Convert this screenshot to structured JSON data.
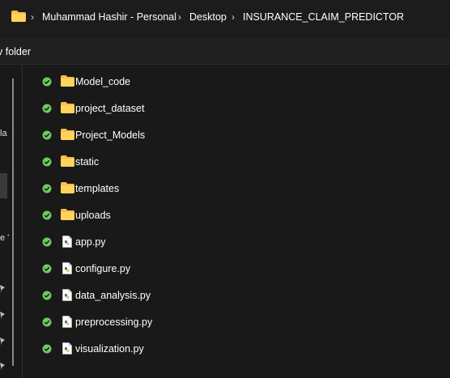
{
  "breadcrumb": [
    "Muhammad Hashir - Personal",
    "Desktop",
    "INSURANCE_CLAIM_PREDICTOR"
  ],
  "breadcrumb_separator": "›",
  "toolbar": {
    "new_folder_label": "v folder"
  },
  "nav_fragments": [
    "la",
    "e '"
  ],
  "files": [
    {
      "name": "Model_code",
      "type": "folder"
    },
    {
      "name": "project_dataset",
      "type": "folder"
    },
    {
      "name": "Project_Models",
      "type": "folder"
    },
    {
      "name": "static",
      "type": "folder"
    },
    {
      "name": "templates",
      "type": "folder"
    },
    {
      "name": "uploads",
      "type": "folder"
    },
    {
      "name": "app.py",
      "type": "python-file"
    },
    {
      "name": "configure.py",
      "type": "python-file"
    },
    {
      "name": "data_analysis.py",
      "type": "python-file"
    },
    {
      "name": "preprocessing.py",
      "type": "python-file"
    },
    {
      "name": "visualization.py",
      "type": "python-file"
    }
  ],
  "colors": {
    "folder": "#f4c04c",
    "status_synced": "#6ccb5f",
    "background": "#191919"
  },
  "icons": {
    "status": "check-circle-icon",
    "folder": "folder-icon",
    "python": "python-file-icon"
  }
}
